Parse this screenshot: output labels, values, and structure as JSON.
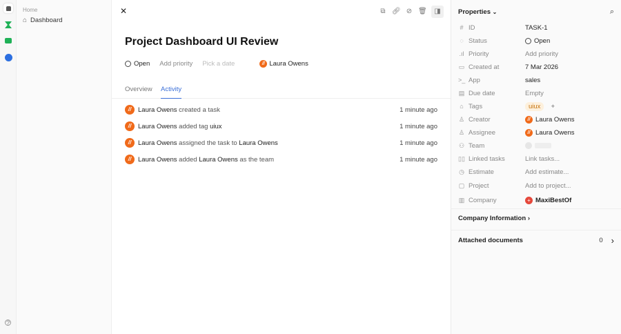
{
  "sidebar": {
    "section": "Home",
    "items": [
      {
        "label": "Dashboard",
        "icon": "home-icon"
      }
    ]
  },
  "task": {
    "title": "Project Dashboard UI Review",
    "status": "Open",
    "priority": "Add priority",
    "date_placeholder": "Pick a date",
    "assignee": "Laura Owens"
  },
  "tabs": [
    {
      "label": "Overview",
      "active": false
    },
    {
      "label": "Activity",
      "active": true
    }
  ],
  "activity": [
    {
      "actor": "Laura Owens",
      "p1": "created a task",
      "time": "1 minute ago"
    },
    {
      "actor": "Laura Owens",
      "p1": "added tag",
      "b1": "uiux",
      "time": "1 minute ago"
    },
    {
      "actor": "Laura Owens",
      "p1": "assigned the task to",
      "b1": "Laura Owens",
      "time": "1 minute ago"
    },
    {
      "actor": "Laura Owens",
      "p1": "added",
      "b1": "Laura Owens",
      "p2": "as the team",
      "time": "1 minute ago"
    }
  ],
  "properties": {
    "title": "Properties",
    "rows": [
      {
        "label": "ID",
        "value": "TASK-1"
      },
      {
        "label": "Status",
        "value": "Open"
      },
      {
        "label": "Priority",
        "value": "Add priority"
      },
      {
        "label": "Created at",
        "value": "7 Mar 2026"
      },
      {
        "label": "App",
        "value": "sales"
      },
      {
        "label": "Due date",
        "value": "Empty"
      },
      {
        "label": "Tags",
        "value": "uiux",
        "add": "+"
      },
      {
        "label": "Creator",
        "value": "Laura Owens"
      },
      {
        "label": "Assignee",
        "value": "Laura Owens"
      },
      {
        "label": "Team",
        "value": ""
      },
      {
        "label": "Linked tasks",
        "value": "Link tasks..."
      },
      {
        "label": "Estimate",
        "value": "Add estimate..."
      },
      {
        "label": "Project",
        "value": "Add to project..."
      },
      {
        "label": "Company",
        "value": "MaxiBestOf"
      }
    ]
  },
  "company_info": "Company Information",
  "attached": {
    "label": "Attached documents",
    "count": "0"
  },
  "colors": {
    "accent": "#3b6fd8",
    "avatar": "#f06a1a",
    "company": "#e5483b",
    "tag_bg": "#fdf0dc",
    "tag_fg": "#c7730e"
  }
}
